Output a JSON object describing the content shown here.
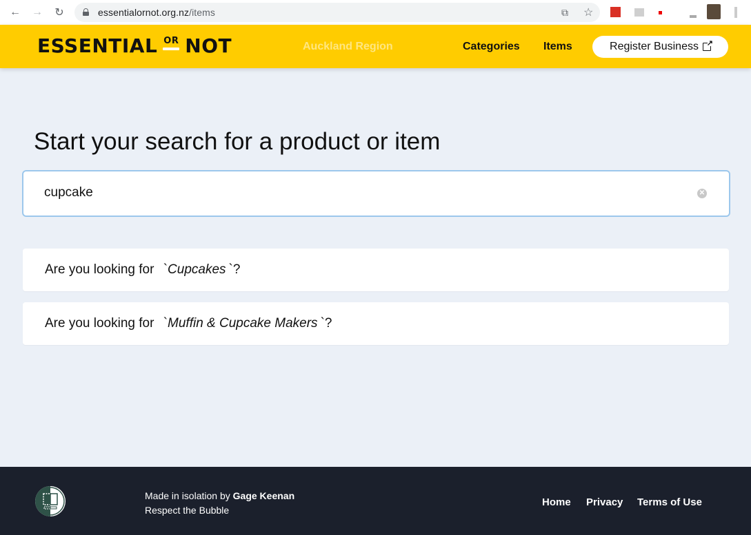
{
  "browser": {
    "url_domain": "essentialornot.org.nz",
    "url_path": "/items",
    "back_icon": "arrow-left-icon",
    "forward_icon": "arrow-right-icon",
    "reload_icon": "reload-icon"
  },
  "header": {
    "logo_left": "ESSENTIAL",
    "logo_or": "OR",
    "logo_right": "NOT",
    "region": "Auckland Region",
    "nav": [
      {
        "label": "Categories"
      },
      {
        "label": "Items"
      }
    ],
    "register_label": "Register Business",
    "colors": {
      "brand": "#ffcc00",
      "footer": "#1b202c",
      "page_bg": "#ebf0f7"
    }
  },
  "main": {
    "title": "Start your search for a product or item",
    "search": {
      "value": "cupcake",
      "placeholder": ""
    },
    "suggestions": [
      {
        "prefix": "Are you looking for ",
        "open": "`",
        "term": "Cupcakes",
        "close": "`?"
      },
      {
        "prefix": "Are you looking for ",
        "open": "`",
        "term": "Muffin & Cupcake Makers",
        "close": "`?"
      }
    ]
  },
  "footer": {
    "made_prefix": "Made in isolation by ",
    "author": "Gage Keenan",
    "tagline": "Respect the Bubble",
    "links": [
      {
        "label": "Home"
      },
      {
        "label": "Privacy"
      },
      {
        "label": "Terms of Use"
      }
    ]
  }
}
